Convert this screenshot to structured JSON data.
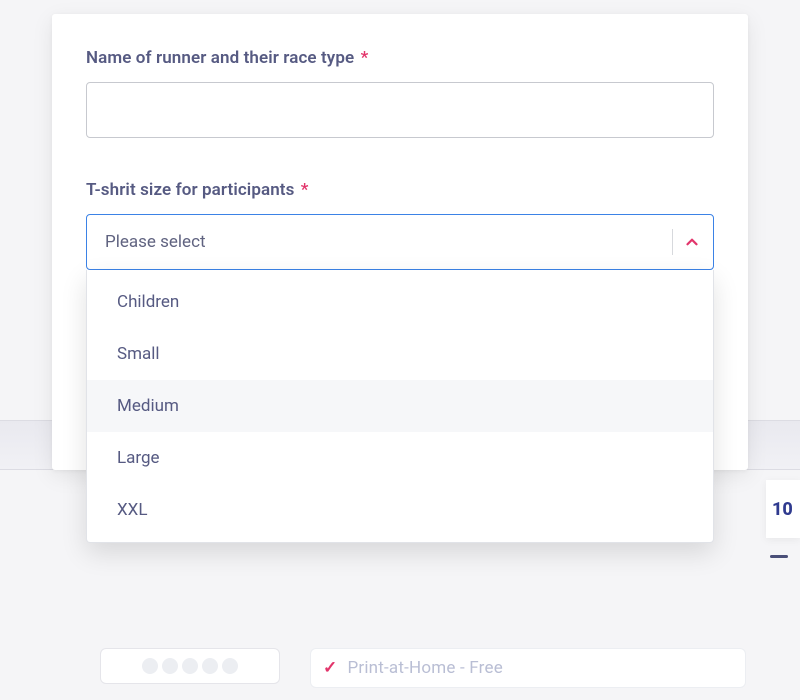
{
  "form": {
    "runner": {
      "label": "Name of runner and their race type",
      "required": "*",
      "value": ""
    },
    "tshirt": {
      "label": "T-shrit size for participants",
      "required": "*",
      "placeholder": "Please select",
      "options": [
        {
          "label": "Children",
          "hover": false
        },
        {
          "label": "Small",
          "hover": false
        },
        {
          "label": "Medium",
          "hover": true
        },
        {
          "label": "Large",
          "hover": false
        },
        {
          "label": "XXL",
          "hover": false
        }
      ]
    }
  },
  "background": {
    "right_fragment": "10",
    "print_label": "Print-at-Home - Free",
    "check": "✓"
  }
}
